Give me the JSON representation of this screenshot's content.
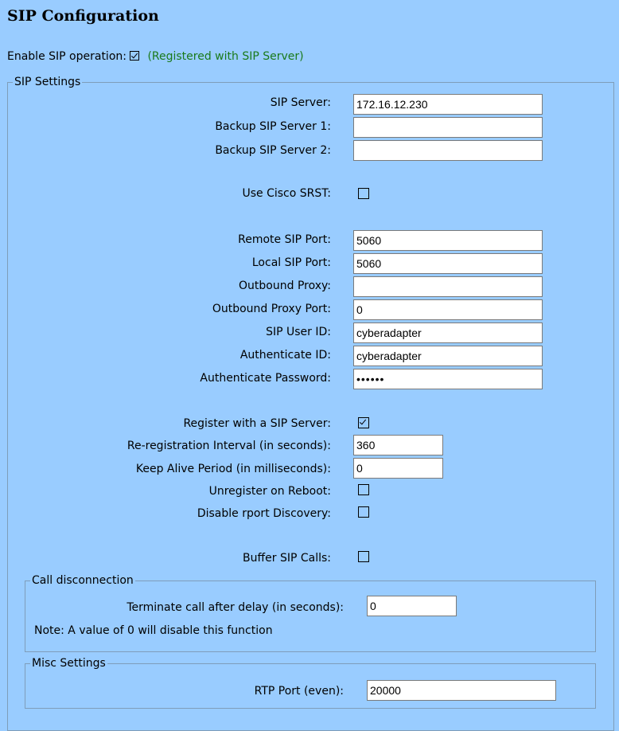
{
  "page": {
    "title": "SIP Configuration",
    "enable_label": "Enable SIP operation:",
    "enable_checked": true,
    "enable_status": "(Registered with SIP Server)"
  },
  "sip_settings": {
    "legend": "SIP Settings",
    "sip_server_label": "SIP Server:",
    "sip_server_value": "172.16.12.230",
    "backup1_label": "Backup SIP Server 1:",
    "backup1_value": "",
    "backup2_label": "Backup SIP Server 2:",
    "backup2_value": "",
    "srst_label": "Use Cisco SRST:",
    "srst_checked": false,
    "remote_port_label": "Remote SIP Port:",
    "remote_port_value": "5060",
    "local_port_label": "Local SIP Port:",
    "local_port_value": "5060",
    "outbound_proxy_label": "Outbound Proxy:",
    "outbound_proxy_value": "",
    "outbound_proxy_port_label": "Outbound Proxy Port:",
    "outbound_proxy_port_value": "0",
    "user_id_label": "SIP User ID:",
    "user_id_value": "cyberadapter",
    "auth_id_label": "Authenticate ID:",
    "auth_id_value": "cyberadapter",
    "auth_pw_label": "Authenticate Password:",
    "auth_pw_value": "••••••",
    "register_label": "Register with a SIP Server:",
    "register_checked": true,
    "rereg_label": "Re-registration Interval (in seconds):",
    "rereg_value": "360",
    "keepalive_label": "Keep Alive Period (in milliseconds):",
    "keepalive_value": "0",
    "unregister_label": "Unregister on Reboot:",
    "unregister_checked": false,
    "rport_label": "Disable rport Discovery:",
    "rport_checked": false,
    "buffer_label": "Buffer SIP Calls:",
    "buffer_checked": false
  },
  "call_disconnection": {
    "legend": "Call disconnection",
    "terminate_label": "Terminate call after delay (in seconds):",
    "terminate_value": "0",
    "note": "Note: A value of 0 will disable this function"
  },
  "misc_settings": {
    "legend": "Misc Settings",
    "rtp_label": "RTP Port (even):",
    "rtp_value": "20000"
  }
}
